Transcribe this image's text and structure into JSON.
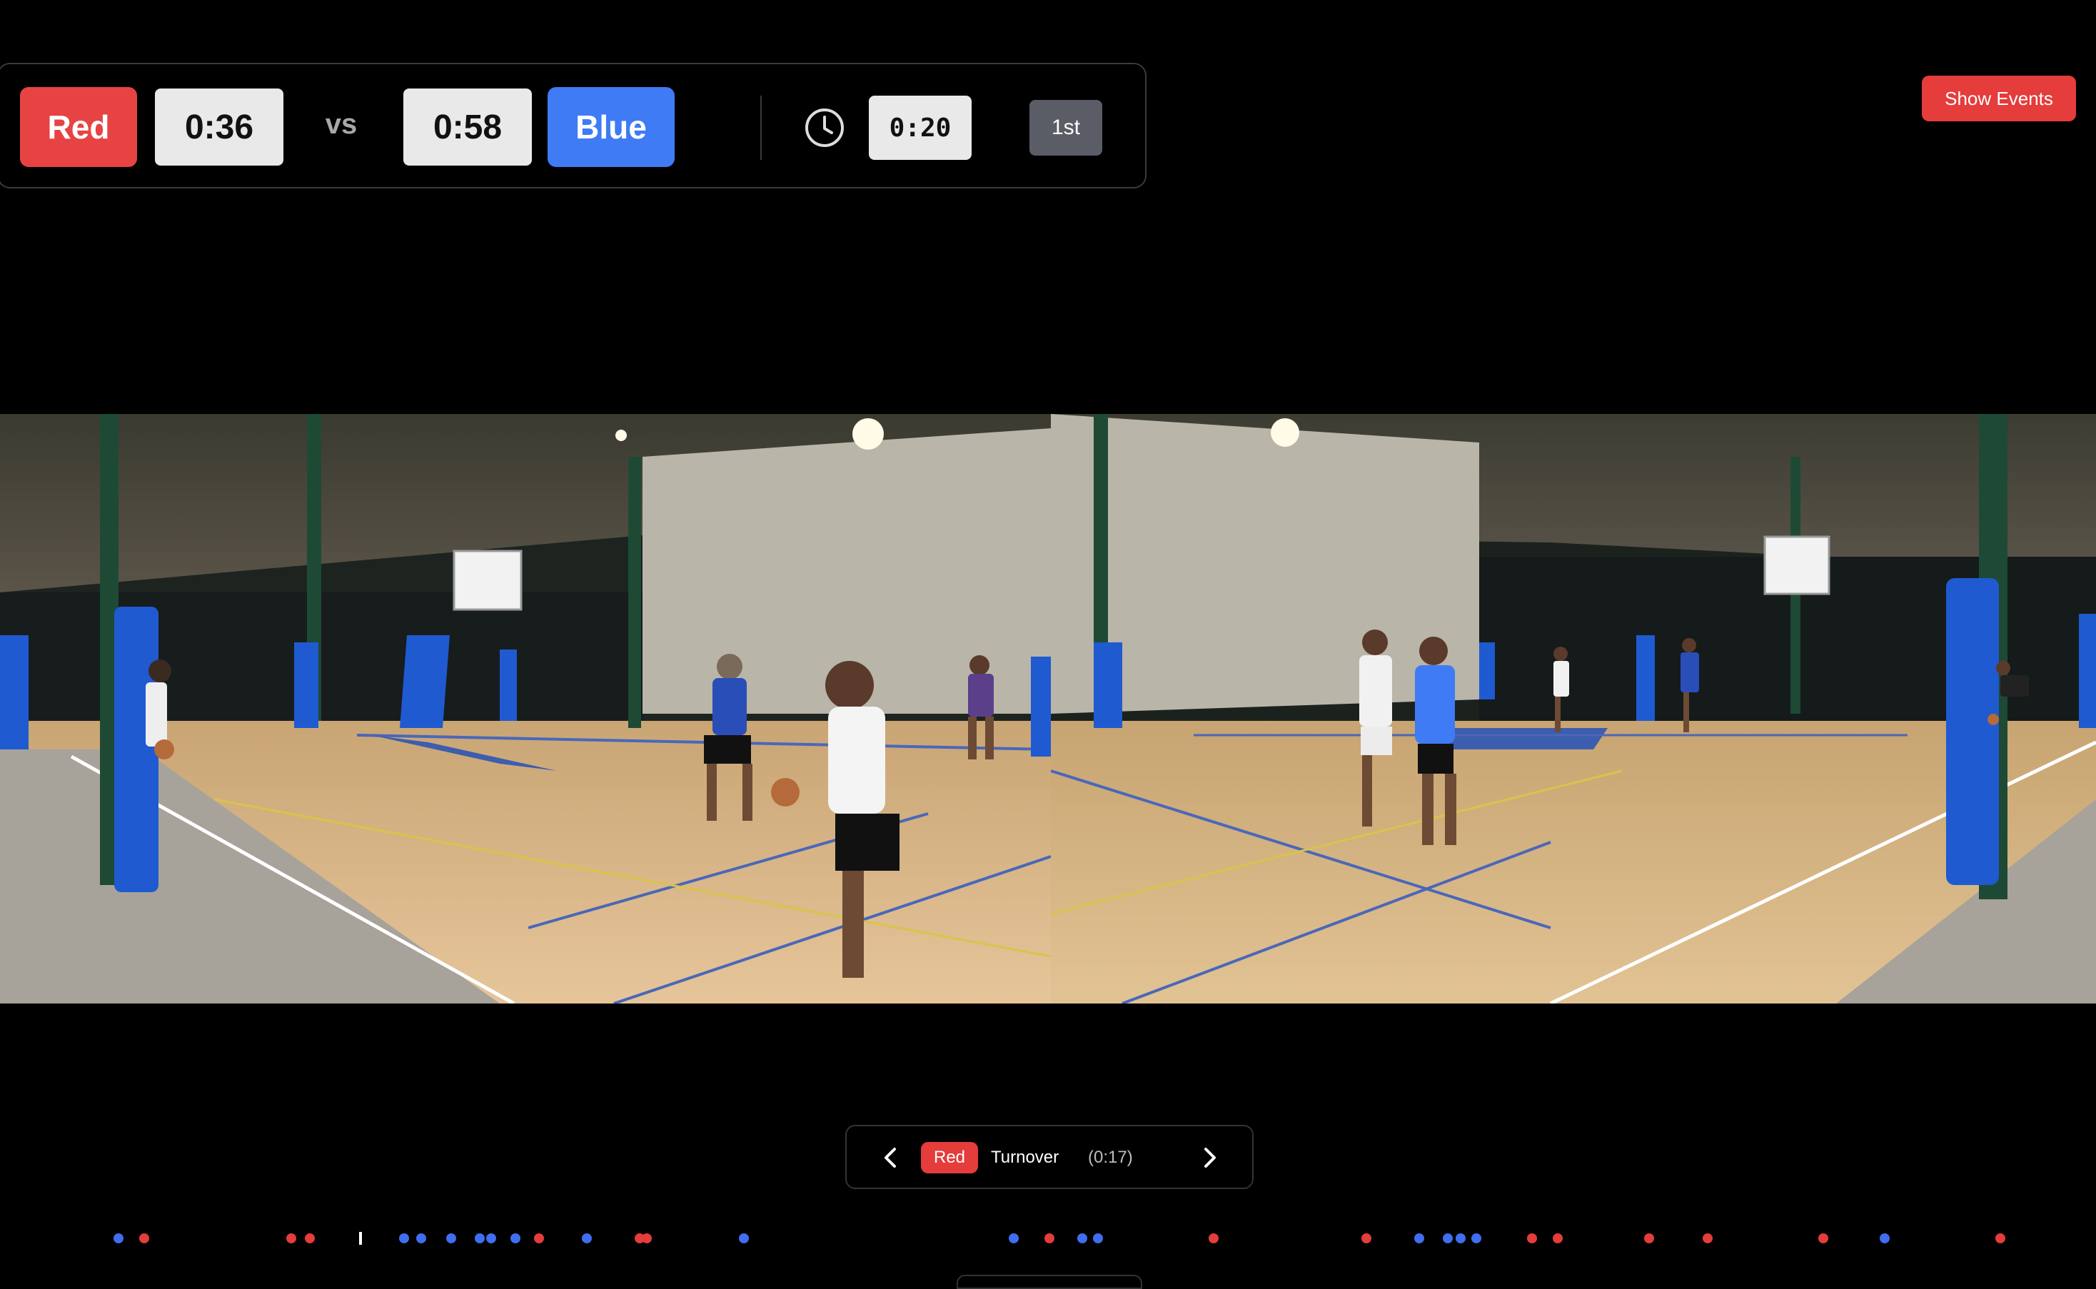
{
  "scoreboard": {
    "home_team": "Red",
    "home_score": "0:36",
    "vs_label": "vs",
    "away_score": "0:58",
    "away_team": "Blue",
    "clock_icon": "clock-icon",
    "game_timer": "0:20",
    "period": "1st"
  },
  "header": {
    "show_events_label": "Show Events"
  },
  "colors": {
    "red_team": "#e74343",
    "blue_team": "#3f7bf5",
    "background": "#000000"
  },
  "event_nav": {
    "prev_icon": "chevron-left-icon",
    "next_icon": "chevron-right-icon",
    "team": "Red",
    "event": "Turnover",
    "time": "(0:17)"
  },
  "timeline": {
    "markers": [
      {
        "team": "blue"
      },
      {
        "team": "red"
      },
      {
        "team": "red"
      },
      {
        "team": "red"
      },
      {
        "team": "playhead"
      },
      {
        "team": "blue"
      },
      {
        "team": "blue"
      },
      {
        "team": "blue"
      },
      {
        "team": "blue"
      },
      {
        "team": "blue"
      },
      {
        "team": "blue"
      },
      {
        "team": "red"
      },
      {
        "team": "blue"
      },
      {
        "team": "red"
      },
      {
        "team": "red"
      },
      {
        "team": "blue"
      },
      {
        "team": "blue"
      },
      {
        "team": "red"
      },
      {
        "team": "blue"
      },
      {
        "team": "blue"
      },
      {
        "team": "red"
      },
      {
        "team": "red"
      },
      {
        "team": "blue"
      },
      {
        "team": "blue"
      },
      {
        "team": "blue"
      },
      {
        "team": "blue"
      },
      {
        "team": "red"
      },
      {
        "team": "red"
      },
      {
        "team": "red"
      },
      {
        "team": "red"
      },
      {
        "team": "red"
      },
      {
        "team": "blue"
      },
      {
        "team": "red"
      }
    ]
  }
}
